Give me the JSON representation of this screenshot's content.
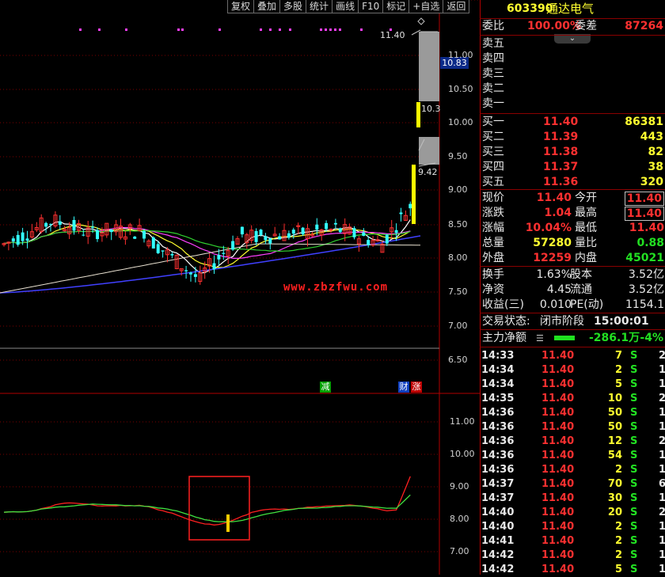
{
  "toolbar": {
    "buttons": [
      "复权",
      "叠加",
      "多股",
      "统计",
      "画线",
      "F10",
      "标记",
      "+自选",
      "返回"
    ]
  },
  "chart": {
    "watermark": "www.zbzfwu.com",
    "main_price_labels": [
      "11.00",
      "10.50",
      "10.00",
      "9.50",
      "9.00",
      "8.50",
      "8.00",
      "7.50",
      "7.00",
      "6.50"
    ],
    "sub_price_labels": [
      "11.00",
      "10.00",
      "9.00",
      "8.00",
      "7.00"
    ],
    "tag_high": "11.40",
    "tag_10_83": "10.83",
    "tag_10_3": "10.3",
    "tag_9_42": "9.42",
    "marker_jian": "减",
    "marker_cai": "财",
    "marker_zhang": "涨",
    "colors": {
      "up": "#ff3030",
      "down": "#33ffff",
      "ma5": "#ffffff",
      "ma10": "#ffff30",
      "ma20": "#ff40ff",
      "ma30": "#30d030",
      "ma60": "#4040ff",
      "accent": "#c00000"
    }
  },
  "panel": {
    "stock_code": "603390",
    "stock_name": "通达电气",
    "weibi_label": "委比",
    "weibi_value": "100.00%",
    "weicha_label": "委差",
    "weicha_value": "87264",
    "sell": [
      {
        "label": "卖五"
      },
      {
        "label": "卖四"
      },
      {
        "label": "卖三"
      },
      {
        "label": "卖二"
      },
      {
        "label": "卖一"
      }
    ],
    "buy": [
      {
        "label": "买一",
        "price": "11.40",
        "vol": "86381"
      },
      {
        "label": "买二",
        "price": "11.39",
        "vol": "443"
      },
      {
        "label": "买三",
        "price": "11.38",
        "vol": "82"
      },
      {
        "label": "买四",
        "price": "11.37",
        "vol": "38"
      },
      {
        "label": "买五",
        "price": "11.36",
        "vol": "320"
      }
    ],
    "quote": [
      {
        "l1": "现价",
        "v1": "11.40",
        "l2": "今开",
        "v2": "11.40"
      },
      {
        "l1": "涨跌",
        "v1": "1.04",
        "l2": "最高",
        "v2": "11.40"
      },
      {
        "l1": "涨幅",
        "v1": "10.04%",
        "l2": "最低",
        "v2": "11.40"
      },
      {
        "l1": "总量",
        "v1": "57280",
        "l2": "量比",
        "v2": "0.88"
      },
      {
        "l1": "外盘",
        "v1": "12259",
        "l2": "内盘",
        "v2": "45021"
      }
    ],
    "stats": [
      {
        "l1": "换手",
        "v1": "1.63%",
        "l2": "股本",
        "v2": "3.52亿"
      },
      {
        "l1": "净资",
        "v1": "4.45",
        "l2": "流通",
        "v2": "3.52亿"
      },
      {
        "l1": "收益(三)",
        "v1": "0.010",
        "l2": "PE(动)",
        "v2": "1154.1"
      }
    ],
    "status_label": "交易状态:",
    "status_value": "闭市阶段",
    "status_time": "15:00:01",
    "net_label": "主力净额",
    "net_value": "-286.1万",
    "net_pct": "-4%",
    "ticks": [
      {
        "t": "14:33",
        "p": "11.40",
        "v": "7",
        "s": "S",
        "n": "2"
      },
      {
        "t": "14:34",
        "p": "11.40",
        "v": "2",
        "s": "S",
        "n": "1"
      },
      {
        "t": "14:34",
        "p": "11.40",
        "v": "5",
        "s": "S",
        "n": "1"
      },
      {
        "t": "14:35",
        "p": "11.40",
        "v": "10",
        "s": "S",
        "n": "2"
      },
      {
        "t": "14:36",
        "p": "11.40",
        "v": "50",
        "s": "S",
        "n": "1"
      },
      {
        "t": "14:36",
        "p": "11.40",
        "v": "50",
        "s": "S",
        "n": "1"
      },
      {
        "t": "14:36",
        "p": "11.40",
        "v": "12",
        "s": "S",
        "n": "2"
      },
      {
        "t": "14:36",
        "p": "11.40",
        "v": "54",
        "s": "S",
        "n": "1"
      },
      {
        "t": "14:36",
        "p": "11.40",
        "v": "2",
        "s": "S",
        "n": "1"
      },
      {
        "t": "14:37",
        "p": "11.40",
        "v": "70",
        "s": "S",
        "n": "6"
      },
      {
        "t": "14:37",
        "p": "11.40",
        "v": "30",
        "s": "S",
        "n": "1"
      },
      {
        "t": "14:40",
        "p": "11.40",
        "v": "20",
        "s": "S",
        "n": "2"
      },
      {
        "t": "14:40",
        "p": "11.40",
        "v": "2",
        "s": "S",
        "n": "1"
      },
      {
        "t": "14:41",
        "p": "11.40",
        "v": "2",
        "s": "S",
        "n": "1"
      },
      {
        "t": "14:42",
        "p": "11.40",
        "v": "2",
        "s": "S",
        "n": "1"
      },
      {
        "t": "14:42",
        "p": "11.40",
        "v": "5",
        "s": "S",
        "n": "1"
      }
    ]
  }
}
